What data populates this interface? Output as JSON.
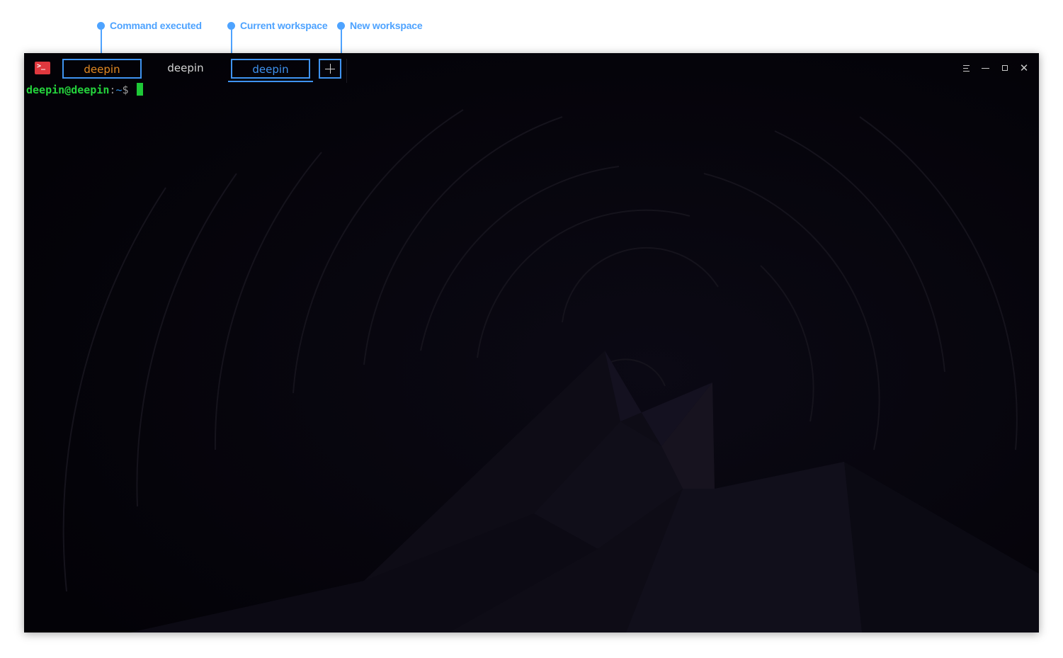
{
  "annotations": [
    {
      "label": "Command executed"
    },
    {
      "label": "Current workspace"
    },
    {
      "label": "New workspace"
    }
  ],
  "window": {
    "app_icon_glyph": ">_",
    "tabs": [
      {
        "label": "deepin",
        "state": "command-executed",
        "color": "#e28a23"
      },
      {
        "label": "deepin",
        "state": "idle",
        "color": "#d4d4d4"
      },
      {
        "label": "deepin",
        "state": "current",
        "color": "#3f93f0"
      }
    ],
    "add_tab_icon": "plus-icon",
    "controls": [
      "menu-icon",
      "minimize-icon",
      "maximize-icon",
      "close-icon"
    ],
    "close_glyph": "✕"
  },
  "terminal": {
    "prompt_user": "deepin@deepin",
    "prompt_sep": ":",
    "prompt_path": "~",
    "prompt_sign": "$"
  },
  "colors": {
    "accent": "#3f93f0",
    "callout": "#4ea3ff",
    "prompt_green": "#24d33c",
    "background": "#040308"
  }
}
